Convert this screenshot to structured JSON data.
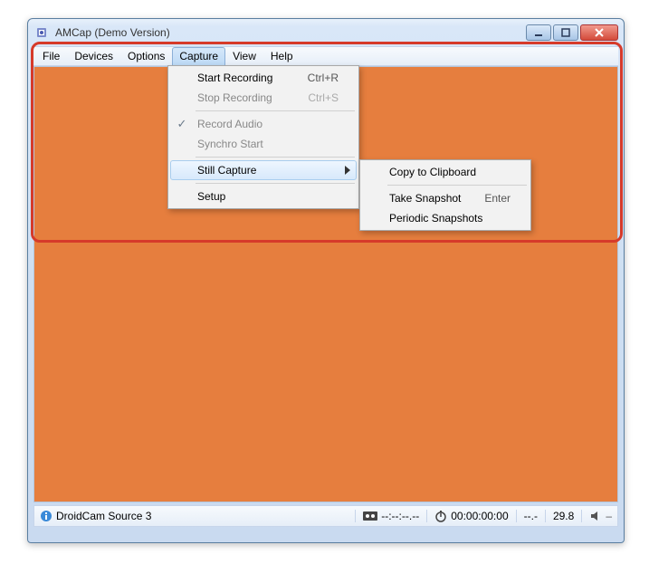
{
  "window": {
    "title": "AMCap (Demo Version)"
  },
  "menubar": {
    "file": "File",
    "devices": "Devices",
    "options": "Options",
    "capture": "Capture",
    "view": "View",
    "help": "Help"
  },
  "capture_menu": {
    "start_recording": {
      "label": "Start Recording",
      "shortcut": "Ctrl+R"
    },
    "stop_recording": {
      "label": "Stop Recording",
      "shortcut": "Ctrl+S"
    },
    "record_audio": {
      "label": "Record Audio",
      "checked": true
    },
    "synchro_start": {
      "label": "Synchro Start"
    },
    "still_capture": {
      "label": "Still Capture"
    },
    "setup": {
      "label": "Setup"
    }
  },
  "still_submenu": {
    "copy_clipboard": {
      "label": "Copy to Clipboard"
    },
    "take_snapshot": {
      "label": "Take Snapshot",
      "shortcut": "Enter"
    },
    "periodic_snapshots": {
      "label": "Periodic Snapshots"
    }
  },
  "status": {
    "source": "DroidCam Source 3",
    "tape_time": "--:--:--.--",
    "clock_time": "00:00:00:00",
    "dropped": "--.-",
    "fps": "29.8"
  }
}
